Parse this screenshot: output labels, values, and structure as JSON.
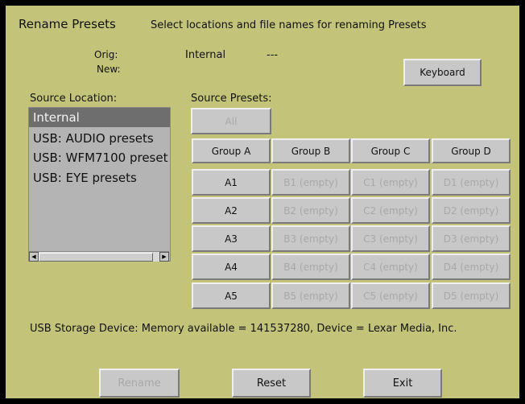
{
  "header": {
    "title": "Rename Presets",
    "subtitle": "Select locations and file names for renaming Presets"
  },
  "names": {
    "orig_label": "Orig:",
    "orig_value": "Internal",
    "orig_name": "---",
    "new_label": "New:"
  },
  "keyboard_label": "Keyboard",
  "source_location": {
    "label": "Source Location:",
    "items": [
      "Internal",
      "USB: AUDIO presets",
      "USB: WFM7100 preset",
      "USB: EYE presets"
    ],
    "selected": "Internal"
  },
  "source_presets": {
    "label": "Source Presets:",
    "all_label": "All",
    "groups": [
      "Group A",
      "Group B",
      "Group C",
      "Group D"
    ],
    "rows": [
      [
        "A1",
        "B1 (empty)",
        "C1 (empty)",
        "D1 (empty)"
      ],
      [
        "A2",
        "B2 (empty)",
        "C2 (empty)",
        "D2 (empty)"
      ],
      [
        "A3",
        "B3 (empty)",
        "C3 (empty)",
        "D3 (empty)"
      ],
      [
        "A4",
        "B4 (empty)",
        "C4 (empty)",
        "D4 (empty)"
      ],
      [
        "A5",
        "B5 (empty)",
        "C5 (empty)",
        "D5 (empty)"
      ]
    ]
  },
  "status": "USB Storage Device:  Memory available = 141537280, Device = Lexar Media, Inc.",
  "footer": {
    "rename_label": "Rename",
    "reset_label": "Reset",
    "exit_label": "Exit"
  },
  "colors": {
    "panel": "#c3c47a",
    "button": "#c8c8c8",
    "disabled_text": "#a8a8a8",
    "selection": "#6e6e6e"
  }
}
